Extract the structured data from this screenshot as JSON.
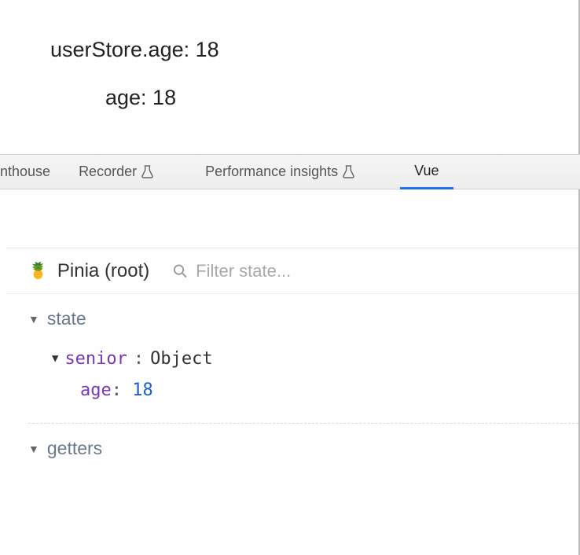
{
  "page": {
    "line1": "userStore.age: 18",
    "line2": "age: 18"
  },
  "tabs": {
    "lighthouse": "nthouse",
    "recorder": "Recorder",
    "perf": "Performance insights",
    "vue": "Vue"
  },
  "inspector": {
    "title": "Pinia (root)",
    "filter_placeholder": "Filter state..."
  },
  "sections": {
    "state": "state",
    "getters": "getters"
  },
  "state_tree": {
    "senior_key": "senior",
    "senior_type": "Object",
    "age_key": "age",
    "age_value": "18"
  }
}
